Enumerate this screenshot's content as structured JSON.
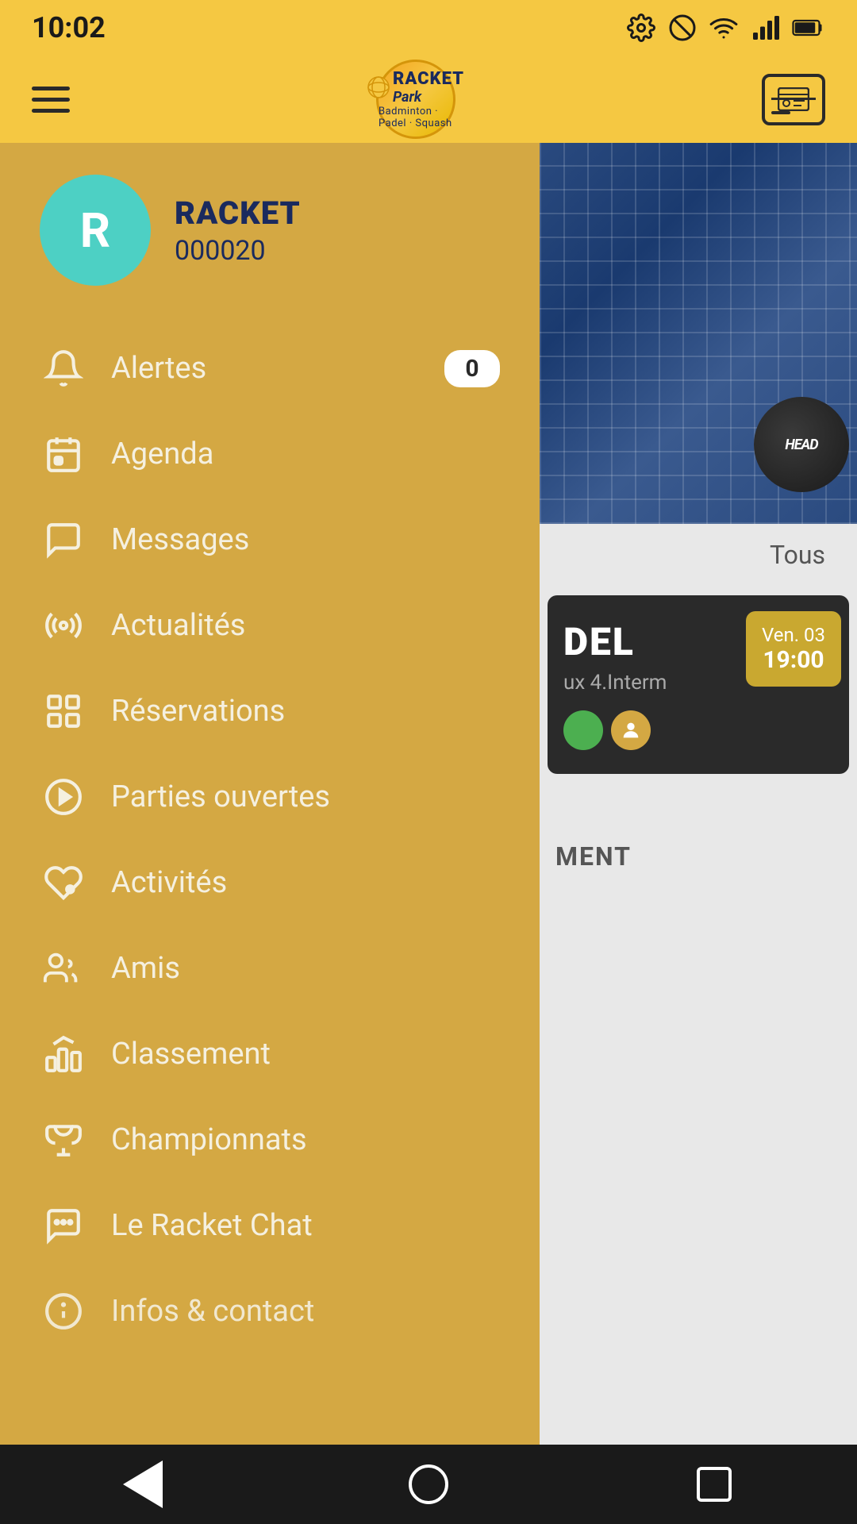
{
  "status": {
    "time": "10:02",
    "icons": [
      "settings",
      "no-disturb",
      "wifi",
      "signal",
      "battery"
    ]
  },
  "header": {
    "logo_top": "RACKET",
    "logo_bottom": "Park",
    "logo_subtitle": "Badminton · Padel · Squash"
  },
  "user": {
    "initial": "R",
    "name": "RACKET",
    "id": "000020"
  },
  "menu": {
    "items": [
      {
        "id": "alertes",
        "label": "Alertes",
        "icon": "bell",
        "badge": "0"
      },
      {
        "id": "agenda",
        "label": "Agenda",
        "icon": "calendar"
      },
      {
        "id": "messages",
        "label": "Messages",
        "icon": "message-circle"
      },
      {
        "id": "actualites",
        "label": "Actualités",
        "icon": "broadcast"
      },
      {
        "id": "reservations",
        "label": "Réservations",
        "icon": "grid"
      },
      {
        "id": "parties-ouvertes",
        "label": "Parties ouvertes",
        "icon": "play-badge"
      },
      {
        "id": "activites",
        "label": "Activités",
        "icon": "heart"
      },
      {
        "id": "amis",
        "label": "Amis",
        "icon": "people"
      },
      {
        "id": "classement",
        "label": "Classement",
        "icon": "podium"
      },
      {
        "id": "championnats",
        "label": "Championnats",
        "icon": "trophy"
      },
      {
        "id": "le-racket-chat",
        "label": "Le Racket Chat",
        "icon": "chat-alt"
      },
      {
        "id": "infos-contact",
        "label": "Infos & contact",
        "icon": "info-circle"
      }
    ]
  },
  "right_panel": {
    "filter_label": "Tous",
    "card_title": "DEL",
    "card_subtitle": "ux 4.Interm",
    "card_date_label": "Ven. 03",
    "card_time": "19:00",
    "bottom_label": "MENT"
  },
  "bottom_nav": {
    "back_label": "back",
    "home_label": "home",
    "recent_label": "recent"
  }
}
